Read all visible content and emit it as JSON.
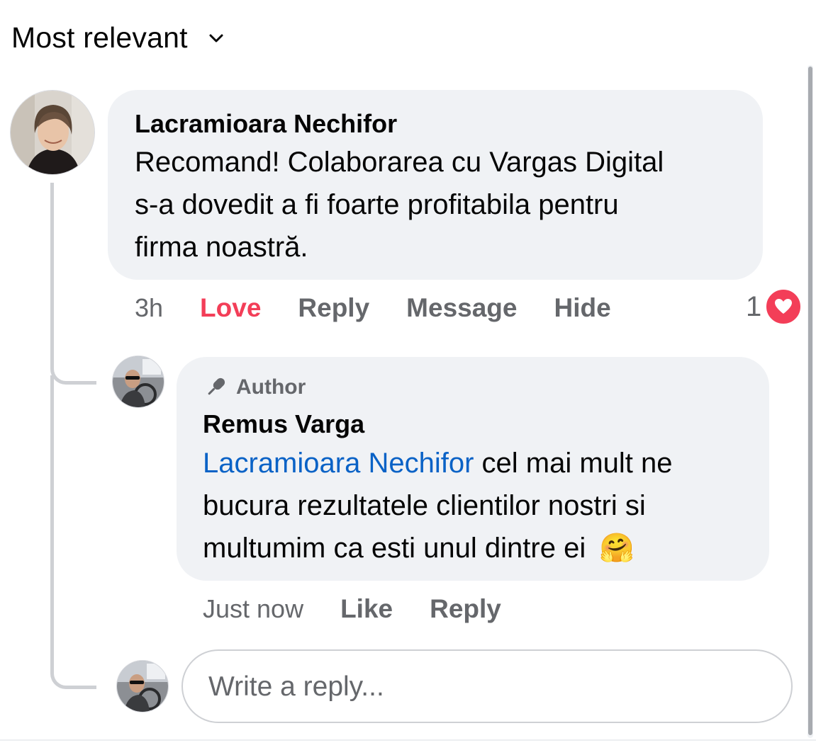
{
  "sort": {
    "label": "Most relevant",
    "icon": "chevron-down-icon"
  },
  "comment": {
    "author": "Lacramioara Nechifor",
    "lines": [
      "Recomand! Colaborarea cu Vargas Digital",
      "s-a dovedit a fi foarte profitabila pentru",
      "firma noastră."
    ],
    "time": "3h",
    "actions": {
      "love": "Love",
      "reply": "Reply",
      "message": "Message",
      "hide": "Hide"
    },
    "reaction": {
      "count": "1",
      "type": "heart-icon"
    }
  },
  "reply": {
    "badge": {
      "icon": "microphone-icon",
      "label": "Author"
    },
    "author": "Remus Varga",
    "mention": "Lacramioara Nechifor",
    "line1_rest": " cel mai mult ne",
    "line2": "bucura rezultatele clientilor nostri si",
    "line3": "multumim ca esti unul dintre ei",
    "emoji": "🤗",
    "time": "Just now",
    "actions": {
      "like": "Like",
      "reply": "Reply"
    }
  },
  "composer": {
    "placeholder": "Write a reply..."
  },
  "colors": {
    "bubble": "#f0f2f5",
    "secondary_text": "#65676b",
    "love": "#f33e58",
    "mention": "#0a62c6",
    "thread_line": "#ced0d4"
  }
}
